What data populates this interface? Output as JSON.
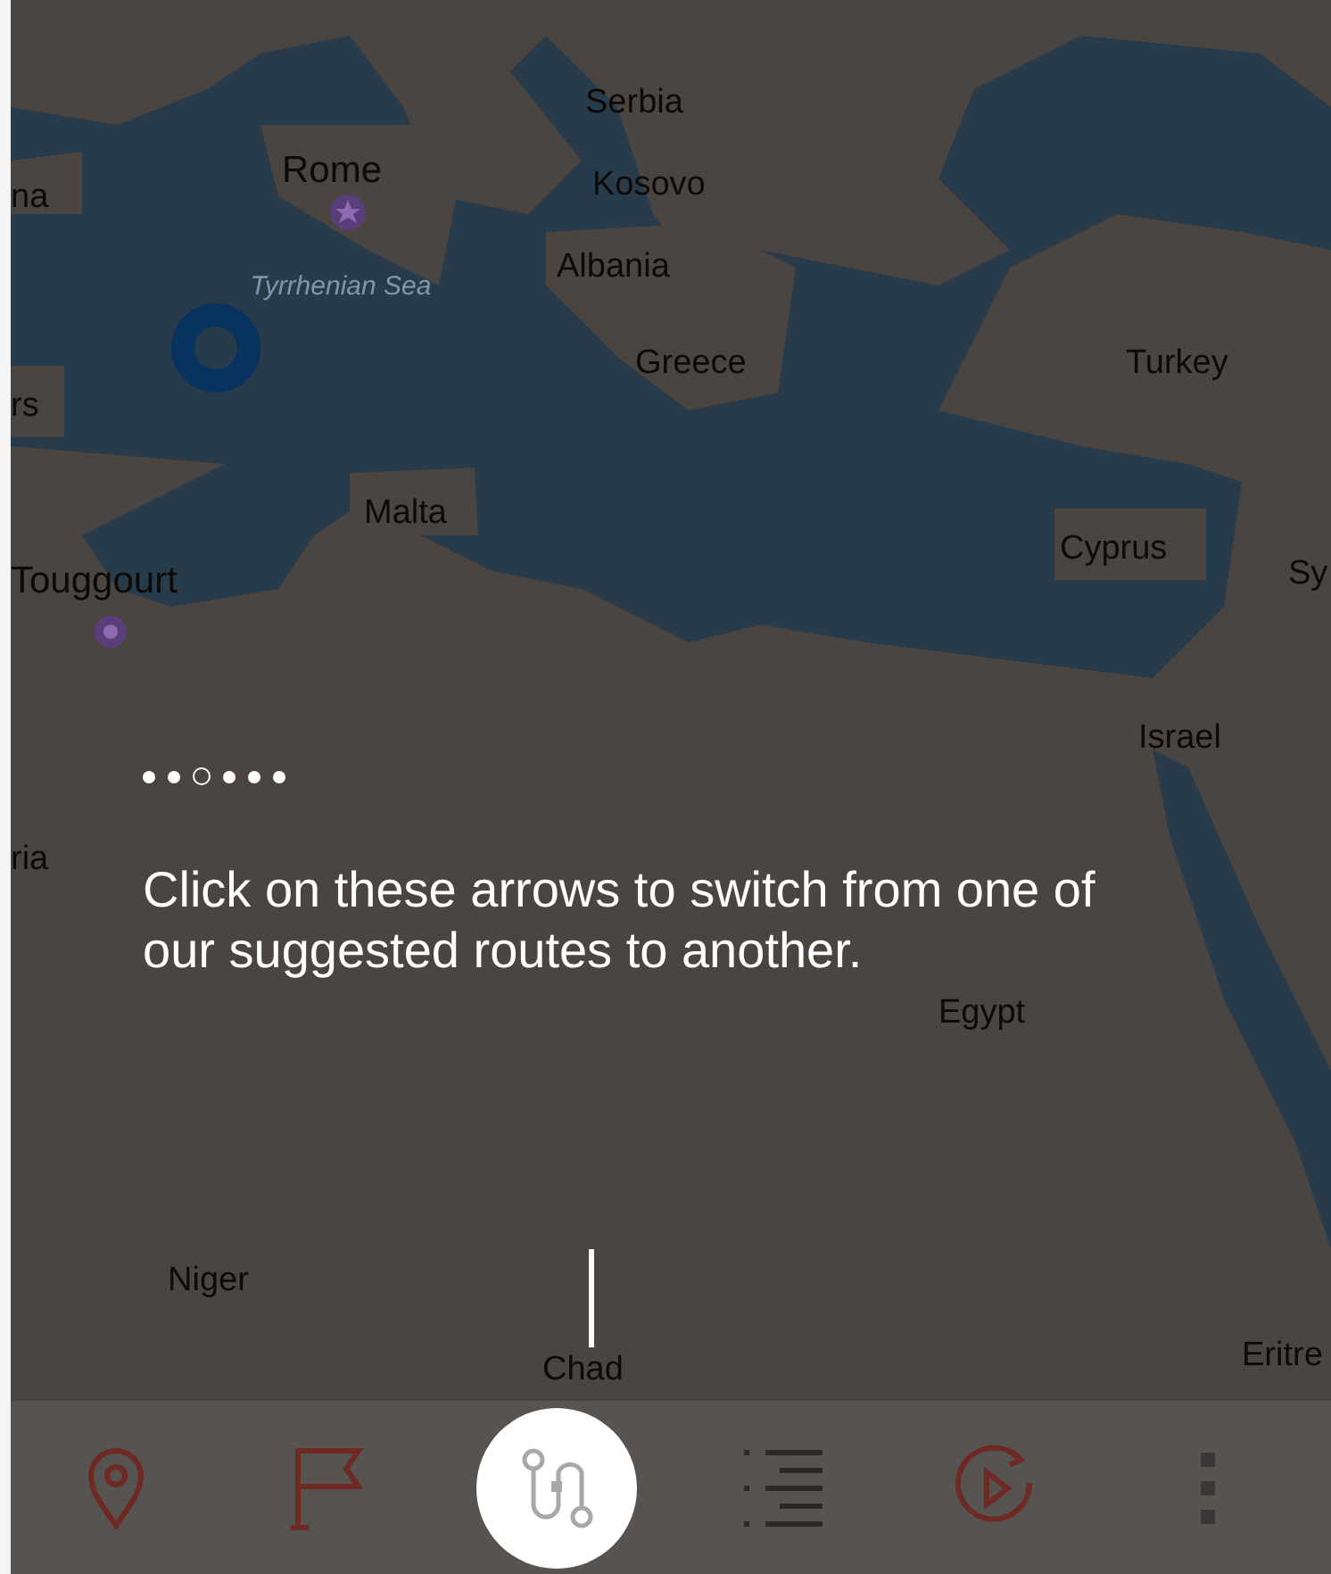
{
  "map": {
    "labels": [
      {
        "text": "Serbia",
        "kind": "country"
      },
      {
        "text": "Rome",
        "kind": "city"
      },
      {
        "text": "Kosovo",
        "kind": "country"
      },
      {
        "text": "na",
        "kind": "country"
      },
      {
        "text": "Albania",
        "kind": "country"
      },
      {
        "text": "Tyrrhenian Sea",
        "kind": "sea"
      },
      {
        "text": "Greece",
        "kind": "country"
      },
      {
        "text": "Turkey",
        "kind": "country"
      },
      {
        "text": "rs",
        "kind": "country"
      },
      {
        "text": "Malta",
        "kind": "country"
      },
      {
        "text": "Cyprus",
        "kind": "country"
      },
      {
        "text": "Sy",
        "kind": "country"
      },
      {
        "text": "Touggourt",
        "kind": "city"
      },
      {
        "text": "Israel",
        "kind": "country"
      },
      {
        "text": "ria",
        "kind": "country"
      },
      {
        "text": "Egypt",
        "kind": "country"
      },
      {
        "text": "Niger",
        "kind": "country"
      },
      {
        "text": "Chad",
        "kind": "country"
      },
      {
        "text": "Eritre",
        "kind": "country"
      }
    ]
  },
  "tour": {
    "pages": [
      {
        "selected": false
      },
      {
        "selected": false
      },
      {
        "selected": true
      },
      {
        "selected": false
      },
      {
        "selected": false
      },
      {
        "selected": false
      }
    ],
    "message": "Click on these arrows to switch from one of our suggested routes to another."
  },
  "toolbar": [
    {
      "kind": "pin",
      "selected": false
    },
    {
      "kind": "flag",
      "selected": false
    },
    {
      "kind": "route",
      "selected": true
    },
    {
      "kind": "list",
      "selected": false
    },
    {
      "kind": "replay",
      "selected": false
    },
    {
      "kind": "more",
      "selected": false
    }
  ]
}
